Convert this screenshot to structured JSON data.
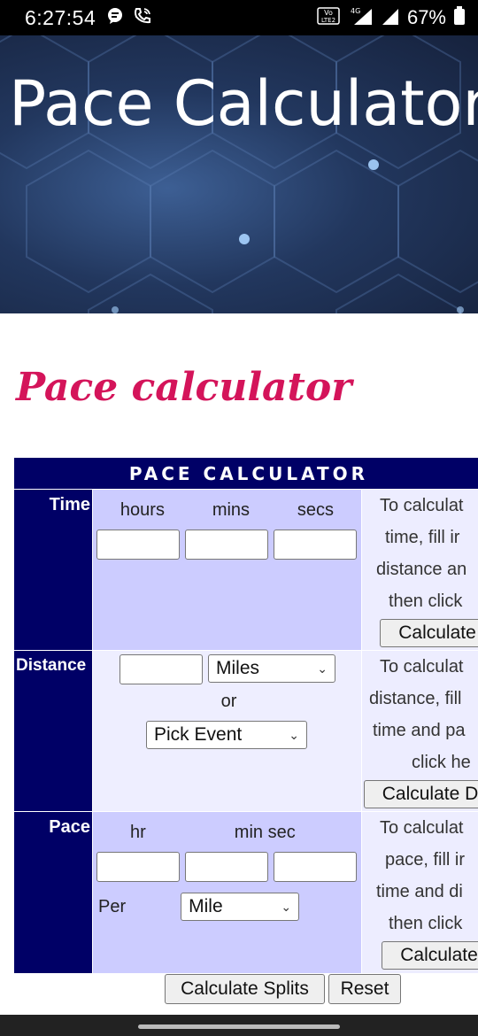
{
  "status_bar": {
    "time": "6:27:54",
    "icons": [
      "chat-bubble-icon",
      "phone-wifi-icon",
      "volte-icon",
      "4g-signal-icon",
      "signal-icon",
      "battery-icon"
    ],
    "volte_line1": "Vo LTE",
    "volte_line2": "LTE 2",
    "network": "4G",
    "battery": "67%"
  },
  "hero": {
    "title": "Pace Calculator"
  },
  "heading": "Pace calculator",
  "calculator": {
    "header": "PACE CALCULATOR",
    "time": {
      "label": "Time",
      "units": [
        "hours",
        "mins",
        "secs"
      ],
      "help": [
        "To calculat",
        "time, fill ir",
        "distance an",
        "then click"
      ],
      "button": "Calculate"
    },
    "distance": {
      "label": "Distance",
      "unit_select": "Miles",
      "or": "or",
      "event_select": "Pick Event",
      "help": [
        "To calculat",
        "distance, fill",
        "time and pa",
        "click he"
      ],
      "button": "Calculate D"
    },
    "pace": {
      "label": "Pace",
      "units": [
        "hr",
        "min sec"
      ],
      "per": "Per",
      "per_select": "Mile",
      "help": [
        "To calculat",
        "pace, fill ir",
        "time and di",
        "then click"
      ],
      "button": "Calculate"
    }
  },
  "bottom": {
    "splits_button": "Calculate Splits",
    "reset_button": "Reset"
  },
  "colors": {
    "header_bg": "#000066",
    "row_bg": "#ccccff",
    "help_bg": "#ededff",
    "heading": "#d4145a"
  }
}
